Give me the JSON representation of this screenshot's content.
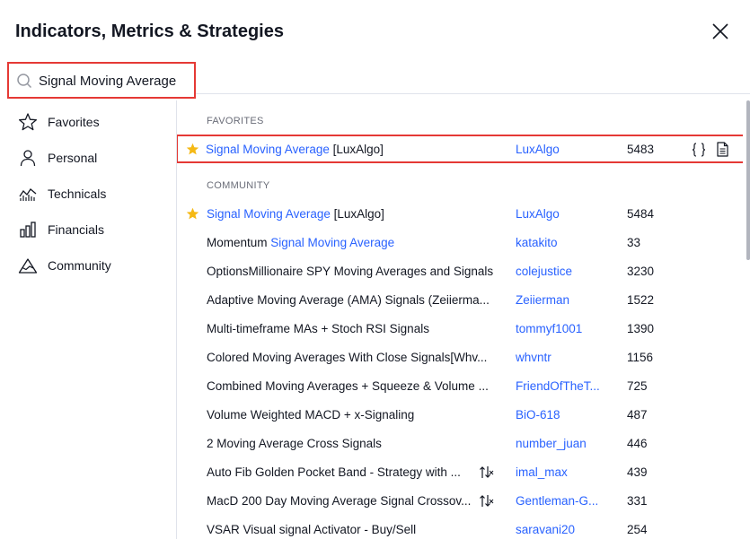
{
  "dialog": {
    "title": "Indicators, Metrics & Strategies"
  },
  "search": {
    "value": "Signal Moving Average",
    "placeholder": "Search"
  },
  "sidebar": {
    "items": [
      {
        "label": "Favorites",
        "icon": "star-outline-icon"
      },
      {
        "label": "Personal",
        "icon": "user-icon"
      },
      {
        "label": "Technicals",
        "icon": "chart-line-icon"
      },
      {
        "label": "Financials",
        "icon": "bar-chart-icon"
      },
      {
        "label": "Community",
        "icon": "mountain-icon"
      }
    ]
  },
  "sections": {
    "favorites": "FAVORITES",
    "community": "COMMUNITY"
  },
  "favorites": [
    {
      "prefix": "",
      "highlight": "Signal Moving Average",
      "suffix": " [LuxAlgo]",
      "author": "LuxAlgo",
      "count": "5483",
      "starred": true
    }
  ],
  "community": [
    {
      "prefix": "",
      "highlight": "Signal Moving Average",
      "suffix": " [LuxAlgo]",
      "author": "LuxAlgo",
      "count": "5484",
      "starred": true,
      "strategy": false
    },
    {
      "prefix": "Momentum ",
      "highlight": "Signal Moving Average",
      "suffix": "",
      "author": "katakito",
      "count": "33",
      "starred": false,
      "strategy": false
    },
    {
      "prefix": "OptionsMillionaire SPY Moving Averages and Signals",
      "highlight": "",
      "suffix": "",
      "author": "colejustice",
      "count": "3230",
      "starred": false,
      "strategy": false
    },
    {
      "prefix": "Adaptive Moving Average (AMA) Signals (Zeiierma...",
      "highlight": "",
      "suffix": "",
      "author": "Zeiierman",
      "count": "1522",
      "starred": false,
      "strategy": false
    },
    {
      "prefix": "Multi-timeframe MAs + Stoch RSI Signals",
      "highlight": "",
      "suffix": "",
      "author": "tommyf1001",
      "count": "1390",
      "starred": false,
      "strategy": false
    },
    {
      "prefix": "Colored Moving Averages With Close Signals[Whv...",
      "highlight": "",
      "suffix": "",
      "author": "whvntr",
      "count": "1156",
      "starred": false,
      "strategy": false
    },
    {
      "prefix": "Combined Moving Averages + Squeeze & Volume ...",
      "highlight": "",
      "suffix": "",
      "author": "FriendOfTheT...",
      "count": "725",
      "starred": false,
      "strategy": false
    },
    {
      "prefix": "Volume Weighted MACD + x-Signaling",
      "highlight": "",
      "suffix": "",
      "author": "BiO-618",
      "count": "487",
      "starred": false,
      "strategy": false
    },
    {
      "prefix": "2 Moving Average Cross Signals",
      "highlight": "",
      "suffix": "",
      "author": "number_juan",
      "count": "446",
      "starred": false,
      "strategy": false
    },
    {
      "prefix": "Auto Fib Golden Pocket Band - Strategy with ...",
      "highlight": "",
      "suffix": "",
      "author": "imal_max",
      "count": "439",
      "starred": false,
      "strategy": true
    },
    {
      "prefix": "MacD 200 Day Moving Average Signal Crossov...",
      "highlight": "",
      "suffix": "",
      "author": "Gentleman-G...",
      "count": "331",
      "starred": false,
      "strategy": true
    },
    {
      "prefix": "VSAR Visual signal Activator - Buy/Sell",
      "highlight": "",
      "suffix": "",
      "author": "saravani20",
      "count": "254",
      "starred": false,
      "strategy": false
    }
  ],
  "colors": {
    "accent": "#2962ff",
    "star": "#f5b915",
    "highlight_border": "#e53935"
  }
}
